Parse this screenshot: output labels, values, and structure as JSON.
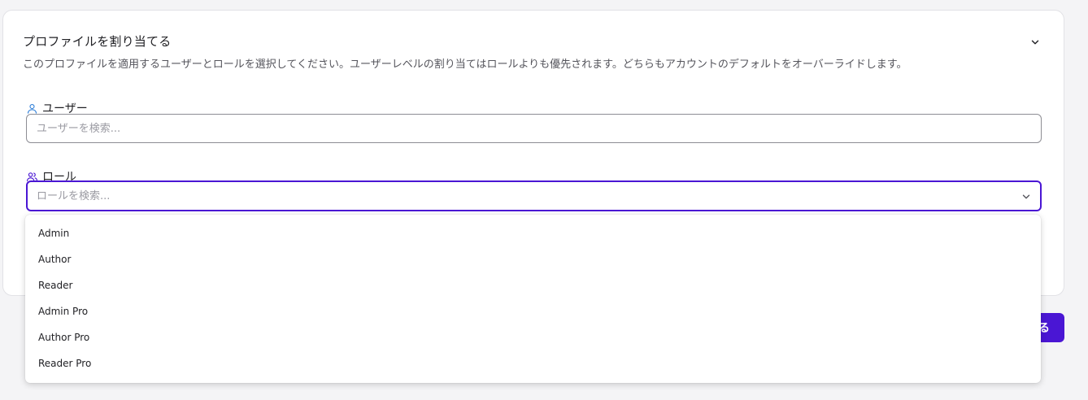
{
  "section": {
    "title": "プロファイルを割り当てる",
    "description": "このプロファイルを適用するユーザーとロールを選択してください。ユーザーレベルの割り当てはロールよりも優先されます。どちらもアカウントのデフォルトをオーバーライドします。"
  },
  "users": {
    "label": "ユーザー",
    "placeholder": "ユーザーを検索...",
    "value": ""
  },
  "roles": {
    "label": "ロール",
    "placeholder": "ロールを検索...",
    "value": "",
    "options": [
      "Admin",
      "Author",
      "Reader",
      "Admin Pro",
      "Author Pro",
      "Reader Pro"
    ]
  },
  "footer": {
    "submit_label_visible": "る"
  },
  "colors": {
    "accent": "#4a16d4",
    "user_icon": "#2f7fd8",
    "role_icon": "#4a16d4"
  }
}
